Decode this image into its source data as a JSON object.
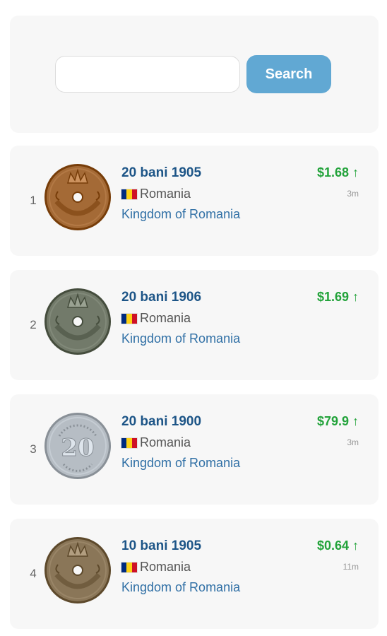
{
  "search": {
    "value": "",
    "placeholder": "",
    "button_label": "Search"
  },
  "results": [
    {
      "rank": "1",
      "title": "20 bani 1905",
      "country": "Romania",
      "period": "Kingdom of Romania",
      "price": "$1.68 ↑",
      "time": "3m",
      "coin_color": "#a46a36",
      "coin_icon": "coin-crown-hole-icon"
    },
    {
      "rank": "2",
      "title": "20 bani 1906",
      "country": "Romania",
      "period": "Kingdom of Romania",
      "price": "$1.69 ↑",
      "time": "",
      "coin_color": "#727a6a",
      "coin_icon": "coin-crown-hole-icon"
    },
    {
      "rank": "3",
      "title": "20 bani 1900",
      "country": "Romania",
      "period": "Kingdom of Romania",
      "price": "$79.9 ↑",
      "time": "3m",
      "coin_color": "#b6bdc4",
      "coin_icon": "coin-numeral-20-icon"
    },
    {
      "rank": "4",
      "title": "10 bani 1905",
      "country": "Romania",
      "period": "Kingdom of Romania",
      "price": "$0.64 ↑",
      "time": "11m",
      "coin_color": "#8a7658",
      "coin_icon": "coin-crown-hole-icon"
    }
  ],
  "flag_colors": [
    "#002b7f",
    "#fcd116",
    "#ce1126"
  ],
  "colors": {
    "accent": "#61a8d3",
    "title": "#1d5587",
    "price_up": "#23a33b"
  }
}
